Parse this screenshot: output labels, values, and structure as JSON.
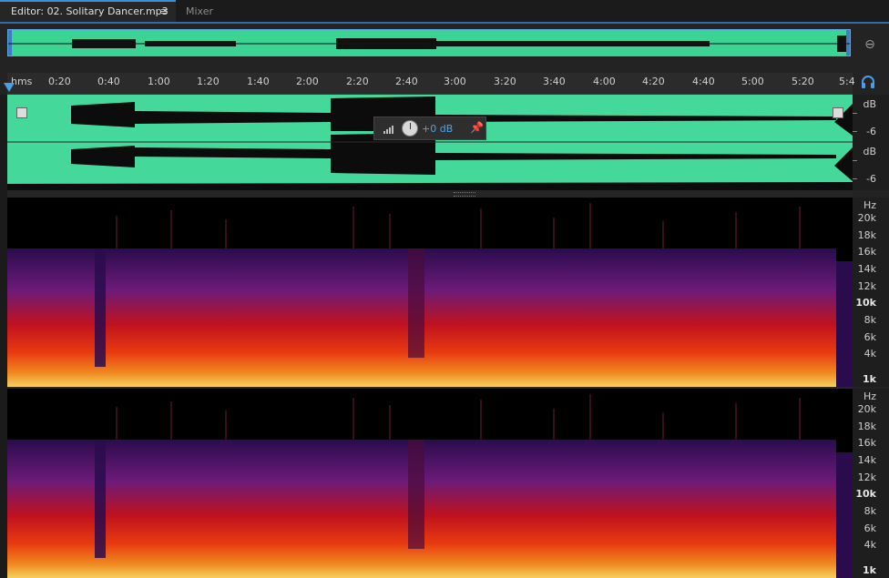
{
  "tabs": {
    "editor": {
      "label": "Editor: 02. Solitary Dancer.mp3",
      "menu_glyph": "≡"
    },
    "mixer": {
      "label": "Mixer"
    }
  },
  "ruler": {
    "unit": "hms",
    "ticks": [
      "0:20",
      "0:40",
      "1:00",
      "1:20",
      "1:40",
      "2:00",
      "2:20",
      "2:40",
      "3:00",
      "3:20",
      "3:40",
      "4:00",
      "4:20",
      "4:40",
      "5:00",
      "5:20",
      "5:4"
    ]
  },
  "gain": {
    "value": "+0 dB"
  },
  "waveform_scale": {
    "channel1": [
      "dB",
      "-6"
    ],
    "channel2": [
      "dB",
      "-6"
    ]
  },
  "spectral_scale": [
    "Hz",
    "20k",
    "18k",
    "16k",
    "14k",
    "12k",
    "10k",
    "8k",
    "6k",
    "4k",
    "1k"
  ],
  "spectral_bold": [
    "10k",
    "1k"
  ],
  "colors": {
    "waveform": "#44d89b",
    "accent": "#3d8fd6",
    "spectrogram": [
      "#000000",
      "#2a0c4e",
      "#6c1a78",
      "#c0121e",
      "#e83a10",
      "#f5d060"
    ]
  },
  "icons": {
    "zoom": "zoom-out-icon",
    "headphones": "headphones-icon",
    "pin": "pin-icon",
    "menu": "menu-icon"
  }
}
